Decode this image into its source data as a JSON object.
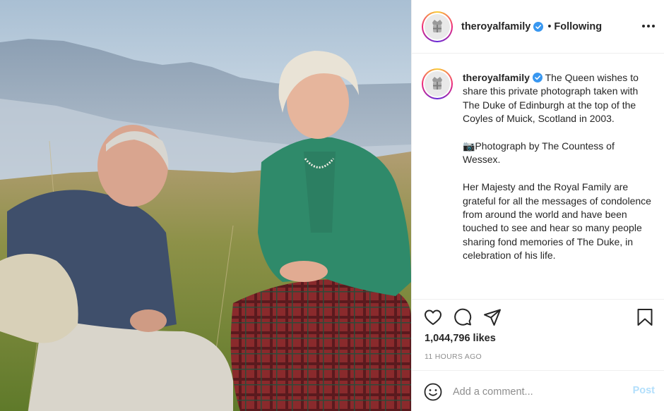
{
  "photo": {
    "alt_subject": "Queen and Duke of Edinburgh seated on heather hillside",
    "icon": "photo-image"
  },
  "header": {
    "username": "theroyalfamily",
    "separator": "•",
    "follow_status": "Following",
    "verified_icon": "verified-badge-icon",
    "more_icon": "more-options-icon"
  },
  "caption": {
    "username": "theroyalfamily",
    "paragraphs": [
      "The Queen wishes to share this private photograph taken with The Duke of Edinburgh at the top of the Coyles of Muick, Scotland in 2003.",
      "📷Photograph by The Countess of Wessex.",
      "Her Majesty and the Royal Family are grateful for all the messages of condolence from around the world and have been touched to see and hear so many people sharing fond memories of The Duke, in celebration of his life."
    ]
  },
  "actions": {
    "like_icon": "heart-icon",
    "comment_icon": "comment-icon",
    "share_icon": "share-icon",
    "save_icon": "bookmark-icon"
  },
  "likes": "1,044,796 likes",
  "timestamp": "11 HOURS AGO",
  "comment": {
    "emoji_icon": "emoji-icon",
    "placeholder": "Add a comment...",
    "value": "",
    "post_label": "Post"
  },
  "colors": {
    "text": "#262626",
    "muted": "#8e8e8e",
    "verified": "#3897f0",
    "post_disabled": "#b2dffc",
    "border": "#efefef"
  }
}
